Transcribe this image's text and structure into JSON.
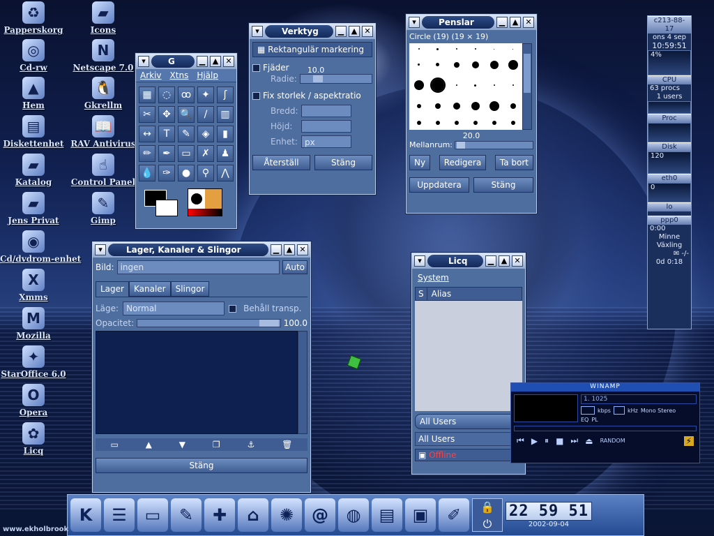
{
  "desktop_icons": [
    {
      "label": "Papperskorg",
      "icon": "recycle-icon"
    },
    {
      "label": "Icons",
      "icon": "folder-icon"
    },
    {
      "label": "Cd-rw",
      "icon": "cd-icon"
    },
    {
      "label": "Netscape 7.0",
      "icon": "netscape-icon"
    },
    {
      "label": "Hem",
      "icon": "home-icon"
    },
    {
      "label": "Gkrellm",
      "icon": "penguin-icon"
    },
    {
      "label": "Diskettenhet",
      "icon": "floppy-icon"
    },
    {
      "label": "RAV Antivirus",
      "icon": "book-icon"
    },
    {
      "label": "Katalog",
      "icon": "folder-icon"
    },
    {
      "label": "Control Panel",
      "icon": "hand-icon"
    },
    {
      "label": "Jens Privat",
      "icon": "folder-icon"
    },
    {
      "label": "Gimp",
      "icon": "brush-icon"
    },
    {
      "label": "Cd/dvdrom-enhet",
      "icon": "cdrom-icon"
    },
    {
      "label": "Xmms",
      "icon": "xmms-icon"
    },
    {
      "label": "Mozilla",
      "icon": "mozilla-icon"
    },
    {
      "label": "StarOffice 6.0",
      "icon": "staroffice-icon"
    },
    {
      "label": "Opera",
      "icon": "opera-icon"
    },
    {
      "label": "Licq",
      "icon": "flower-icon"
    }
  ],
  "gimp_toolbox": {
    "title": "G",
    "menu": [
      "Arkiv",
      "Xtns",
      "Hjälp"
    ]
  },
  "verktyg": {
    "title": "Verktyg",
    "tool_name": "Rektangulär markering",
    "feather_label": "Fjäder",
    "radius_label": "Radie:",
    "radius_value": "10.0",
    "fix_label": "Fix storlek / aspektratio",
    "width_label": "Bredd:",
    "height_label": "Höjd:",
    "unit_label": "Enhet:",
    "unit_value": "px",
    "reset_button": "Återställ",
    "close_button": "Stäng"
  },
  "penslar": {
    "title": "Penslar",
    "brush_name": "Circle (19)  (19 × 19)",
    "spacing_value": "20.0",
    "spacing_label": "Mellanrum:",
    "new_button": "Ny",
    "edit_button": "Redigera",
    "delete_button": "Ta bort",
    "update_button": "Uppdatera",
    "close_button": "Stäng"
  },
  "layers": {
    "title": "Lager, Kanaler & Slingor",
    "image_label": "Bild:",
    "image_value": "ingen",
    "auto_button": "Auto",
    "tabs": [
      "Lager",
      "Kanaler",
      "Slingor"
    ],
    "mode_label": "Läge:",
    "mode_value": "Normal",
    "keep_trans": "Behåll transp.",
    "opacity_label": "Opacitet:",
    "opacity_value": "100.0",
    "close_button": "Stäng"
  },
  "licq": {
    "title": "Licq",
    "menu": "System",
    "col_s": "S",
    "col_alias": "Alias",
    "group1": "All Users",
    "group2": "All Users",
    "status": "Offline"
  },
  "gkrellm": {
    "host": "c213-88-17",
    "date": "ons  4 sep",
    "time": "10:59:51",
    "cpu_pct": "4%",
    "cpu_label": "CPU",
    "procs": "63 procs",
    "users": "1 users",
    "proc_label": "Proc",
    "disk_label": "Disk",
    "disk_value": "120",
    "eth0_label": "eth0",
    "eth0_value": "0",
    "lo_label": "lo",
    "ppp0_label": "ppp0",
    "ppp_time": "0:00",
    "mem_label": "Minne",
    "swap_label": "Växling",
    "mail": "-/-",
    "uptime": "0d  0:18"
  },
  "winamp": {
    "title": "WINAMP",
    "track": "1. 1025",
    "kbps": "kbps",
    "khz": "kHz",
    "mono_stereo": "Mono Stereo",
    "eq": "EQ",
    "pl": "PL",
    "random": "RANDOM"
  },
  "taskbar": {
    "clock": "22 59 51",
    "date": "2002-09-04"
  },
  "watermark": "www.ekholbrook"
}
